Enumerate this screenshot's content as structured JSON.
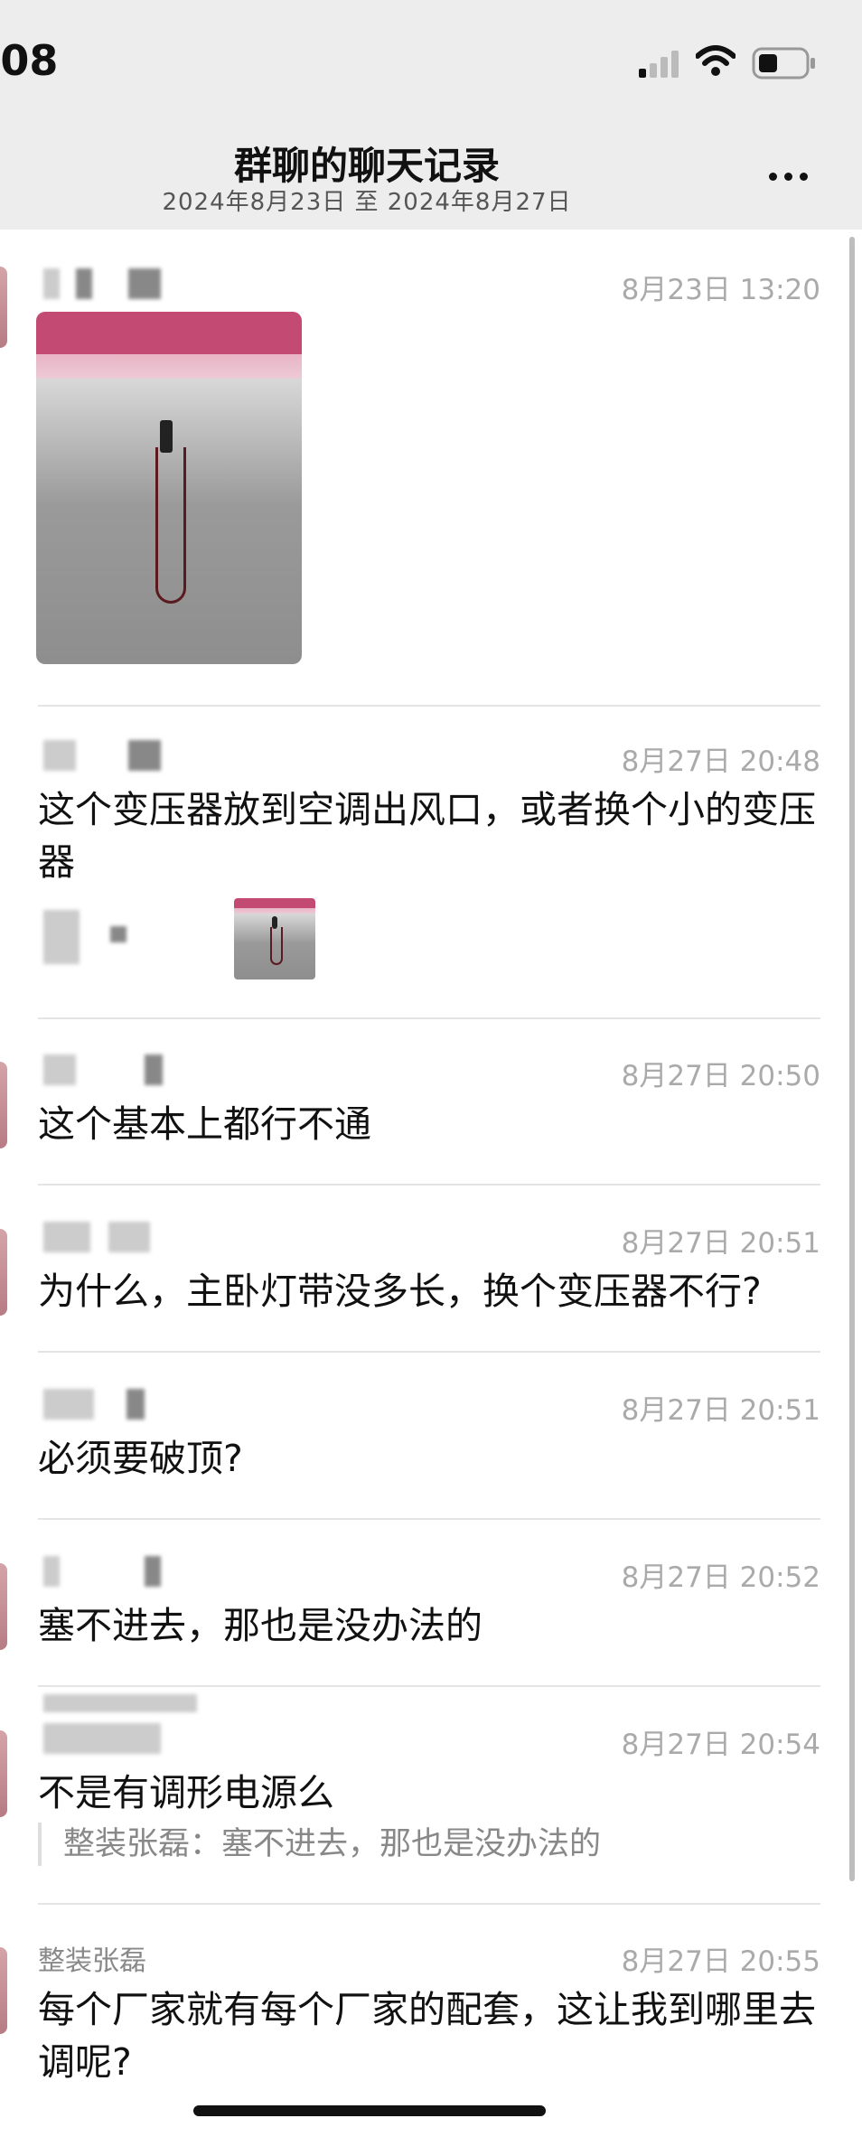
{
  "status_bar": {
    "time": ":08"
  },
  "header": {
    "title": "群聊的聊天记录",
    "subtitle": "2024年8月23日 至 2024年8月27日"
  },
  "messages": [
    {
      "sender": "",
      "time": "8月23日 13:20",
      "type": "image"
    },
    {
      "sender": "",
      "time": "8月27日 20:48",
      "text": "这个变压器放到空调出风口，或者换个小的变压器",
      "attachment": "image"
    },
    {
      "sender": "",
      "time": "8月27日 20:50",
      "text": "这个基本上都行不通"
    },
    {
      "sender": "",
      "time": "8月27日 20:51",
      "text": "为什么，主卧灯带没多长，换个变压器不行?"
    },
    {
      "sender": "",
      "time": "8月27日 20:51",
      "text": "必须要破顶?"
    },
    {
      "sender": "",
      "time": "8月27日 20:52",
      "text": "塞不进去，那也是没办法的"
    },
    {
      "sender": "",
      "time": "8月27日 20:54",
      "text": "不是有调形电源么",
      "quote": "整装张磊：塞不进去，那也是没办法的"
    },
    {
      "sender": "整装张磊",
      "time": "8月27日 20:55",
      "text": "每个厂家就有每个厂家的配套，这让我到哪里去调呢?"
    }
  ],
  "colors": {
    "header_bg": "#ededed",
    "timestamp": "#aaaaaa",
    "quote": "#888888"
  }
}
